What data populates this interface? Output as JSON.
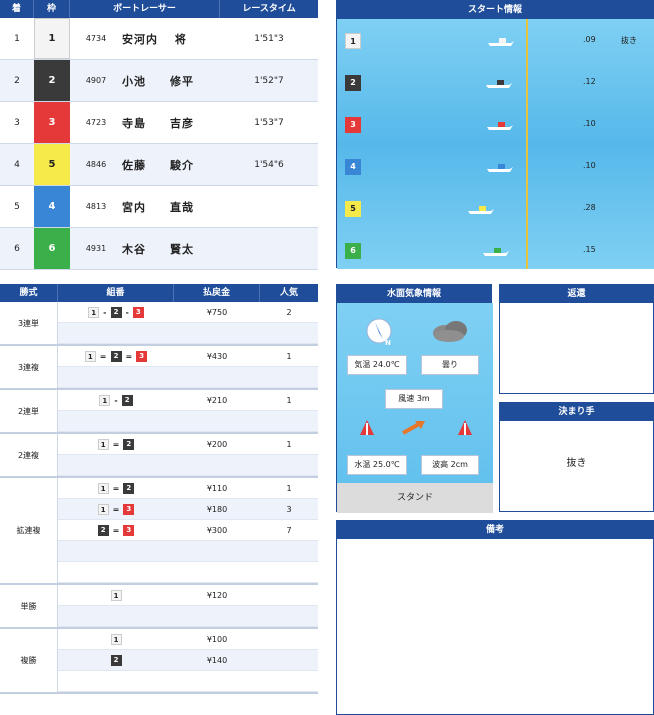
{
  "results": {
    "headers": {
      "rank": "着",
      "waku": "枠",
      "racer": "ボートレーサー",
      "time": "レースタイム"
    },
    "rows": [
      {
        "rank": "1",
        "waku": "1",
        "reg": "4734",
        "name": "安河内　 将",
        "time": "1'51\"3"
      },
      {
        "rank": "2",
        "waku": "2",
        "reg": "4907",
        "name": "小池　　修平",
        "time": "1'52\"7"
      },
      {
        "rank": "3",
        "waku": "3",
        "reg": "4723",
        "name": "寺島　　吉彦",
        "time": "1'53\"7"
      },
      {
        "rank": "4",
        "waku": "5",
        "reg": "4846",
        "name": "佐藤　　駿介",
        "time": "1'54\"6"
      },
      {
        "rank": "5",
        "waku": "4",
        "reg": "4813",
        "name": "宮内　　直哉",
        "time": ""
      },
      {
        "rank": "6",
        "waku": "6",
        "reg": "4931",
        "name": "木谷　　賢太",
        "time": ""
      }
    ]
  },
  "start_info": {
    "title": "スタート情報",
    "rows": [
      {
        "waku": "1",
        "st": ".09",
        "note": "抜き"
      },
      {
        "waku": "2",
        "st": ".12",
        "note": ""
      },
      {
        "waku": "3",
        "st": ".10",
        "note": ""
      },
      {
        "waku": "4",
        "st": ".10",
        "note": ""
      },
      {
        "waku": "5",
        "st": ".28",
        "note": ""
      },
      {
        "waku": "6",
        "st": ".15",
        "note": ""
      }
    ]
  },
  "payout": {
    "headers": {
      "type": "勝式",
      "combo": "組番",
      "amount": "払戻金",
      "popularity": "人気"
    },
    "groups": [
      {
        "label": "3連単",
        "rows": [
          {
            "combo": [
              "1",
              "-",
              "2",
              "-",
              "3"
            ],
            "amount": "¥750",
            "pop": "2"
          },
          {
            "combo": [],
            "amount": "",
            "pop": ""
          }
        ]
      },
      {
        "label": "3連複",
        "rows": [
          {
            "combo": [
              "1",
              "=",
              "2",
              "=",
              "3"
            ],
            "amount": "¥430",
            "pop": "1"
          },
          {
            "combo": [],
            "amount": "",
            "pop": ""
          }
        ]
      },
      {
        "label": "2連単",
        "rows": [
          {
            "combo": [
              "1",
              "-",
              "2"
            ],
            "amount": "¥210",
            "pop": "1"
          },
          {
            "combo": [],
            "amount": "",
            "pop": ""
          }
        ]
      },
      {
        "label": "2連複",
        "rows": [
          {
            "combo": [
              "1",
              "=",
              "2"
            ],
            "amount": "¥200",
            "pop": "1"
          },
          {
            "combo": [],
            "amount": "",
            "pop": ""
          }
        ]
      },
      {
        "label": "拡連複",
        "rows": [
          {
            "combo": [
              "1",
              "=",
              "2"
            ],
            "amount": "¥110",
            "pop": "1"
          },
          {
            "combo": [
              "1",
              "=",
              "3"
            ],
            "amount": "¥180",
            "pop": "3"
          },
          {
            "combo": [
              "2",
              "=",
              "3"
            ],
            "amount": "¥300",
            "pop": "7"
          },
          {
            "combo": [],
            "amount": "",
            "pop": ""
          },
          {
            "combo": [],
            "amount": "",
            "pop": ""
          }
        ]
      },
      {
        "label": "単勝",
        "rows": [
          {
            "combo": [
              "1"
            ],
            "amount": "¥120",
            "pop": ""
          },
          {
            "combo": [],
            "amount": "",
            "pop": ""
          }
        ]
      },
      {
        "label": "複勝",
        "rows": [
          {
            "combo": [
              "1"
            ],
            "amount": "¥100",
            "pop": ""
          },
          {
            "combo": [
              "2"
            ],
            "amount": "¥140",
            "pop": ""
          },
          {
            "combo": [],
            "amount": "",
            "pop": ""
          }
        ]
      }
    ]
  },
  "weather": {
    "title": "水面気象情報",
    "air_temp": "気温 24.0℃",
    "condition": "曇り",
    "wind": "風速 3m",
    "water_temp": "水温 25.0℃",
    "wave": "波高 2cm",
    "stand": "スタンド",
    "compass": "N"
  },
  "henkan": {
    "title": "返還"
  },
  "kimarite": {
    "title": "決まり手",
    "value": "抜き"
  },
  "bikou": {
    "title": "備考"
  },
  "colors": {
    "header": "#1f4d9a",
    "w1": "#f4f4f4",
    "w2": "#3a3a3a",
    "w3": "#e53838",
    "w4": "#3a86d6",
    "w5": "#f6e94a",
    "w6": "#3bb04a"
  }
}
